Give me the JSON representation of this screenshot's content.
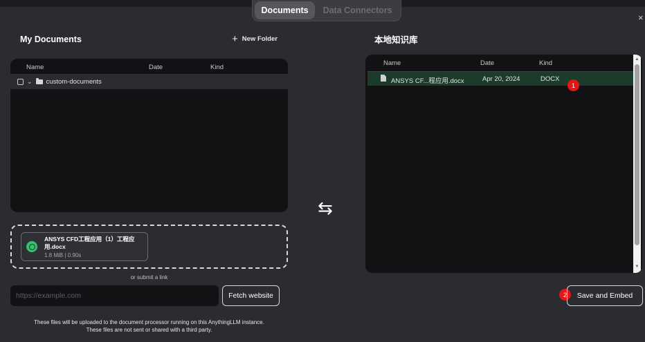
{
  "tabs": [
    {
      "label": "Documents",
      "active": true
    },
    {
      "label": "Data Connectors",
      "active": false
    }
  ],
  "close_symbol": "×",
  "left": {
    "title": "My Documents",
    "new_folder_label": "New Folder",
    "columns": {
      "name": "Name",
      "date": "Date",
      "kind": "Kind"
    },
    "folder": {
      "name": "custom-documents"
    }
  },
  "upload": {
    "file_name": "ANSYS CFD工程应用（1）工程应用.docx",
    "meta": "1.8 MiB | 0.90s",
    "status_color": "#35c26e"
  },
  "or_link_text": "or submit a link",
  "url_input": {
    "placeholder": "https://example.com",
    "value": ""
  },
  "fetch_label": "Fetch website",
  "footnote": {
    "line1": "These files will be uploaded to the document processor running on this AnythingLLM instance.",
    "line2": "These files are not sent or shared with a third party."
  },
  "swap_icon": "⇆",
  "right": {
    "title": "本地知识库",
    "columns": {
      "name": "Name",
      "date": "Date",
      "kind": "Kind"
    },
    "docs": [
      {
        "name": "ANSYS CF...程应用.docx",
        "date": "Apr 20, 2024",
        "kind": "DOCX"
      }
    ]
  },
  "badges": {
    "one": "1",
    "two": "2"
  },
  "save_label": "Save and Embed",
  "colors": {
    "selected_row": "#1d3b2a",
    "badge": "#e01818",
    "panel": "#121214",
    "background": "#2a2c30"
  }
}
